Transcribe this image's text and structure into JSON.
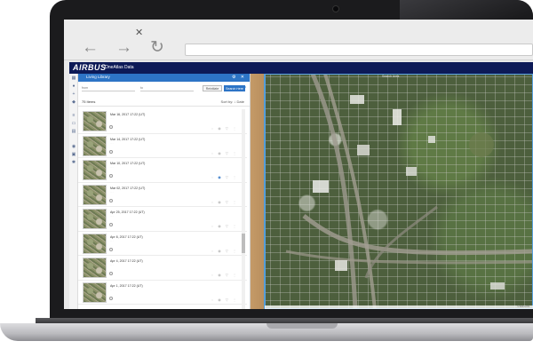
{
  "browser": {
    "tab_close_icon": "✕",
    "back_icon": "←",
    "forward_icon": "→",
    "reload_icon": "↻"
  },
  "app": {
    "brand": "AIRBUS",
    "product": "OneAtlas Data"
  },
  "panel": {
    "title": "Living Library",
    "head_icons": "⚙ ✕",
    "date_from": "from",
    "date_to": "to",
    "btn_reset": "Reinitiate",
    "btn_search": "Search Here",
    "advanced_link": "Hide Advanced",
    "count": "75 Items",
    "sort_label": "Sort by: ↓ Date",
    "items": [
      {
        "date": "Mar 16, 2017 17:22 (UT)",
        "meta": "· · ·",
        "selected": false
      },
      {
        "date": "Mar 14, 2017 17:22 (UT)",
        "meta": "· · ·",
        "selected": false
      },
      {
        "date": "Mar 10, 2017 17:22 (UT)",
        "meta": "· · ·",
        "selected": true
      },
      {
        "date": "Mar 02, 2017 17:22 (UT)",
        "meta": "· · ·",
        "selected": false
      },
      {
        "date": "Apr 25, 2017 17:22 (UT)",
        "meta": "· · ·",
        "selected": false
      },
      {
        "date": "Apr 8, 2017 17:22 (UT)",
        "meta": "· · ·",
        "selected": false
      },
      {
        "date": "Apr 4, 2017 17:22 (UT)",
        "meta": "· · ·",
        "selected": false
      },
      {
        "date": "Apr 1, 2017 17:22 (UT)",
        "meta": "· · ·",
        "selected": false
      }
    ]
  },
  "map": {
    "title": "Search Area",
    "footer": "© Airbus DS"
  }
}
